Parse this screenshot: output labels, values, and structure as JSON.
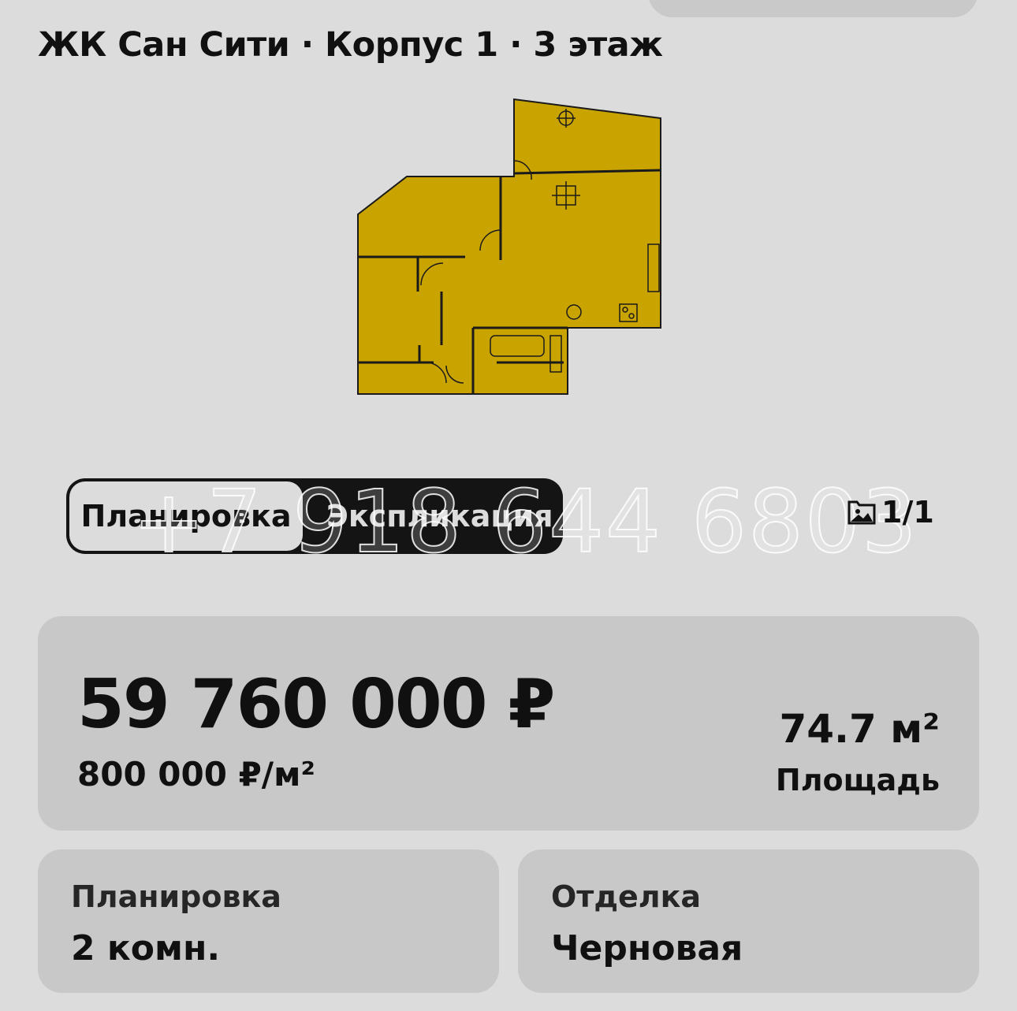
{
  "header": {
    "title": "ЖК Сан Сити · Корпус 1 · 3 этаж"
  },
  "plan_tabs": [
    {
      "label": "Планировка",
      "active": true
    },
    {
      "label": "Экспликация",
      "active": false
    }
  ],
  "watermark": "+7 918 644 6803",
  "gallery": {
    "counter": "1/1",
    "icon": "image-gallery-icon"
  },
  "price_card": {
    "price": "59 760 000 ₽",
    "price_per_m": "800 000 ₽/м²",
    "area_value": "74.7 м²",
    "area_label": "Площадь"
  },
  "info_cards": [
    {
      "label": "Планировка",
      "value": "2 комн."
    },
    {
      "label": "Отделка",
      "value": "Черновая"
    }
  ],
  "colors": {
    "background": "#dcdcdc",
    "card": "#c8c8c8",
    "floorplan_fill": "#c9a400",
    "tab_dark": "#141414"
  }
}
